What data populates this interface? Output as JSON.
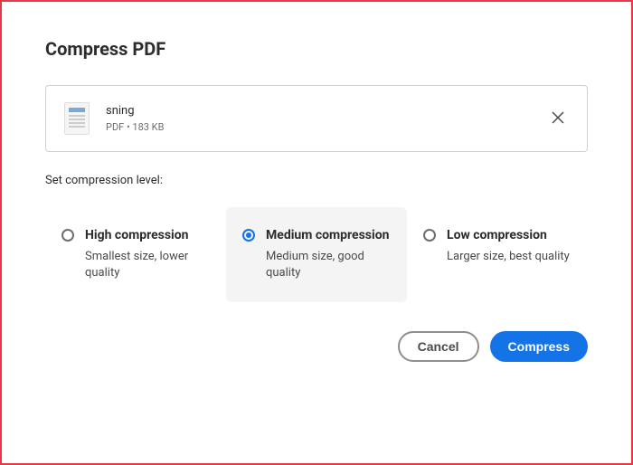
{
  "title": "Compress PDF",
  "file": {
    "name": "sning",
    "meta": "PDF • 183 KB"
  },
  "sectionLabel": "Set compression level:",
  "options": {
    "high": {
      "title": "High compression",
      "desc": "Smallest size, lower quality"
    },
    "medium": {
      "title": "Medium compression",
      "desc": "Medium size, good quality"
    },
    "low": {
      "title": "Low compression",
      "desc": "Larger size, best quality"
    }
  },
  "buttons": {
    "cancel": "Cancel",
    "compress": "Compress"
  }
}
